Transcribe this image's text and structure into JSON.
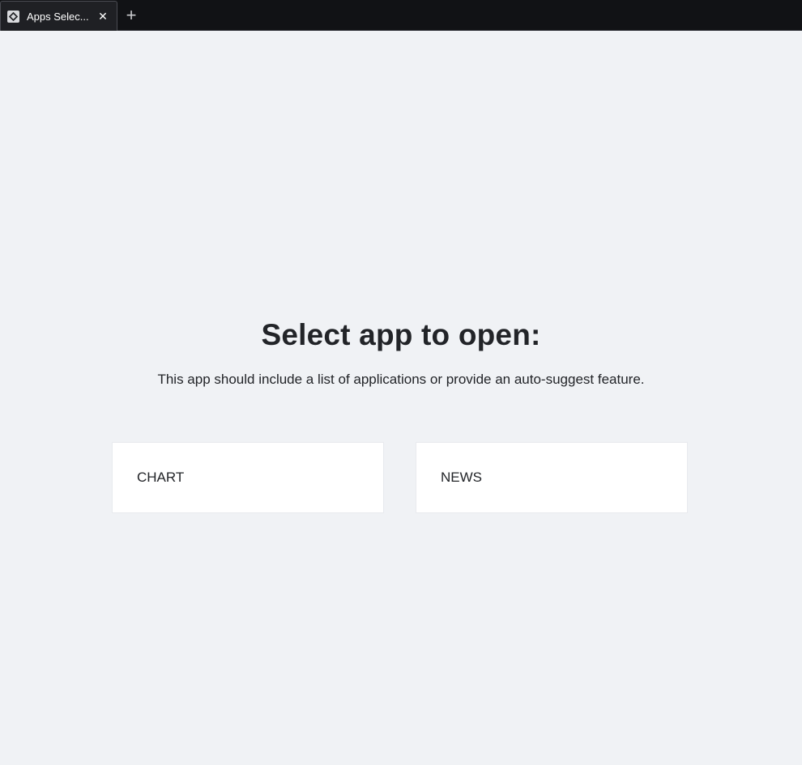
{
  "browser": {
    "tabs": [
      {
        "title": "Apps Selec...",
        "icon": "app-diamond-icon",
        "active": true
      }
    ],
    "close_glyph": "✕",
    "new_tab_glyph": "+"
  },
  "page": {
    "heading": "Select app to open:",
    "subtitle": "This app should include a list of applications or provide an auto-suggest feature.",
    "apps": [
      {
        "label": "CHART"
      },
      {
        "label": "NEWS"
      }
    ]
  },
  "colors": {
    "background": "#f0f2f5",
    "tabbar": "#111215",
    "card": "#ffffff",
    "text": "#222428"
  }
}
